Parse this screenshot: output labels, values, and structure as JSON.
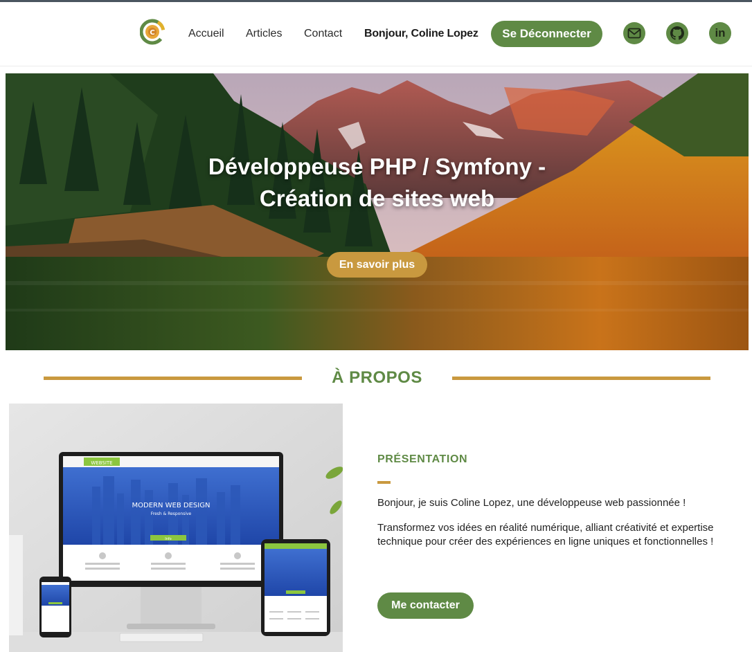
{
  "header": {
    "logo_letter": "C",
    "nav": {
      "home": "Accueil",
      "articles": "Articles",
      "contact": "Contact"
    },
    "greeting": "Bonjour, Coline Lopez",
    "logout_label": "Se Déconnecter",
    "social_icons": [
      "mail-icon",
      "github-icon",
      "linkedin-icon"
    ],
    "linkedin_text": "in"
  },
  "hero": {
    "title_line1": "Développeuse PHP / Symfony -",
    "title_line2": "Création de sites web",
    "button_label": "En savoir plus"
  },
  "about": {
    "section_title": "À PROPOS",
    "subtitle": "PRÉSENTATION",
    "paragraph1": "Bonjour, je suis Coline Lopez, une développeuse web passionnée !",
    "paragraph2": "Transformez vos idées en réalité numérique, alliant créativité et expertise technique pour créer des expériences en ligne uniques et fonctionnelles !",
    "contact_button": "Me contacter",
    "mockup": {
      "nav_label": "WEBSITE",
      "headline": "MODERN WEB DESIGN",
      "tagline": "Fresh & Responsive",
      "cta": "Info"
    }
  },
  "colors": {
    "green": "#5f8a45",
    "gold": "#c9993f"
  }
}
